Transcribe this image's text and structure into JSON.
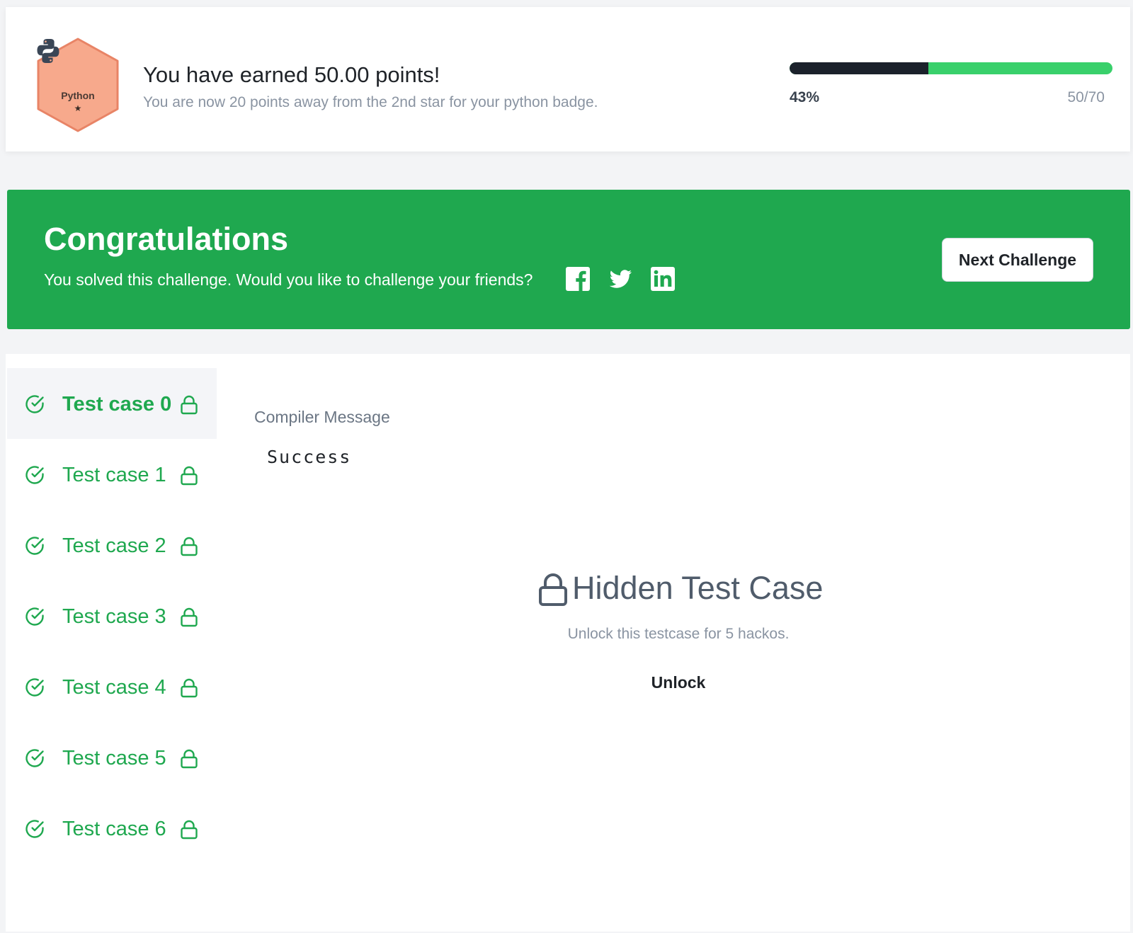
{
  "badge": {
    "name": "Python",
    "stars": "★",
    "color": "#f7a98c",
    "border_color": "#e88466",
    "icon": "python-logo-icon"
  },
  "points": {
    "title": "You have earned 50.00 points!",
    "subtitle": "You are now 20 points away from the 2nd star for your python badge.",
    "progress_fraction": 0.43,
    "progress_percent_label": "43%",
    "progress_count_label": "50/70",
    "progress_filled_color": "#1b212b",
    "progress_remaining_color": "#39d06b"
  },
  "congrats": {
    "title": "Congratulations",
    "subtitle": "You solved this challenge. Would you like to challenge your friends?",
    "background_color": "#1fa84f",
    "share_icons": [
      "facebook-icon",
      "twitter-icon",
      "linkedin-icon"
    ],
    "next_button_label": "Next Challenge"
  },
  "test_cases": {
    "items": [
      {
        "label": "Test case 0",
        "status": "passed",
        "locked": true,
        "active": true
      },
      {
        "label": "Test case 1",
        "status": "passed",
        "locked": true,
        "active": false
      },
      {
        "label": "Test case 2",
        "status": "passed",
        "locked": true,
        "active": false
      },
      {
        "label": "Test case 3",
        "status": "passed",
        "locked": true,
        "active": false
      },
      {
        "label": "Test case 4",
        "status": "passed",
        "locked": true,
        "active": false
      },
      {
        "label": "Test case 5",
        "status": "passed",
        "locked": true,
        "active": false
      },
      {
        "label": "Test case 6",
        "status": "passed",
        "locked": true,
        "active": false
      }
    ],
    "accent_color": "#1fa84f"
  },
  "detail": {
    "compiler_label": "Compiler Message",
    "compiler_value": "Success",
    "hidden_title": "Hidden Test Case",
    "hidden_subtitle": "Unlock this testcase for 5 hackos.",
    "unlock_label": "Unlock"
  }
}
